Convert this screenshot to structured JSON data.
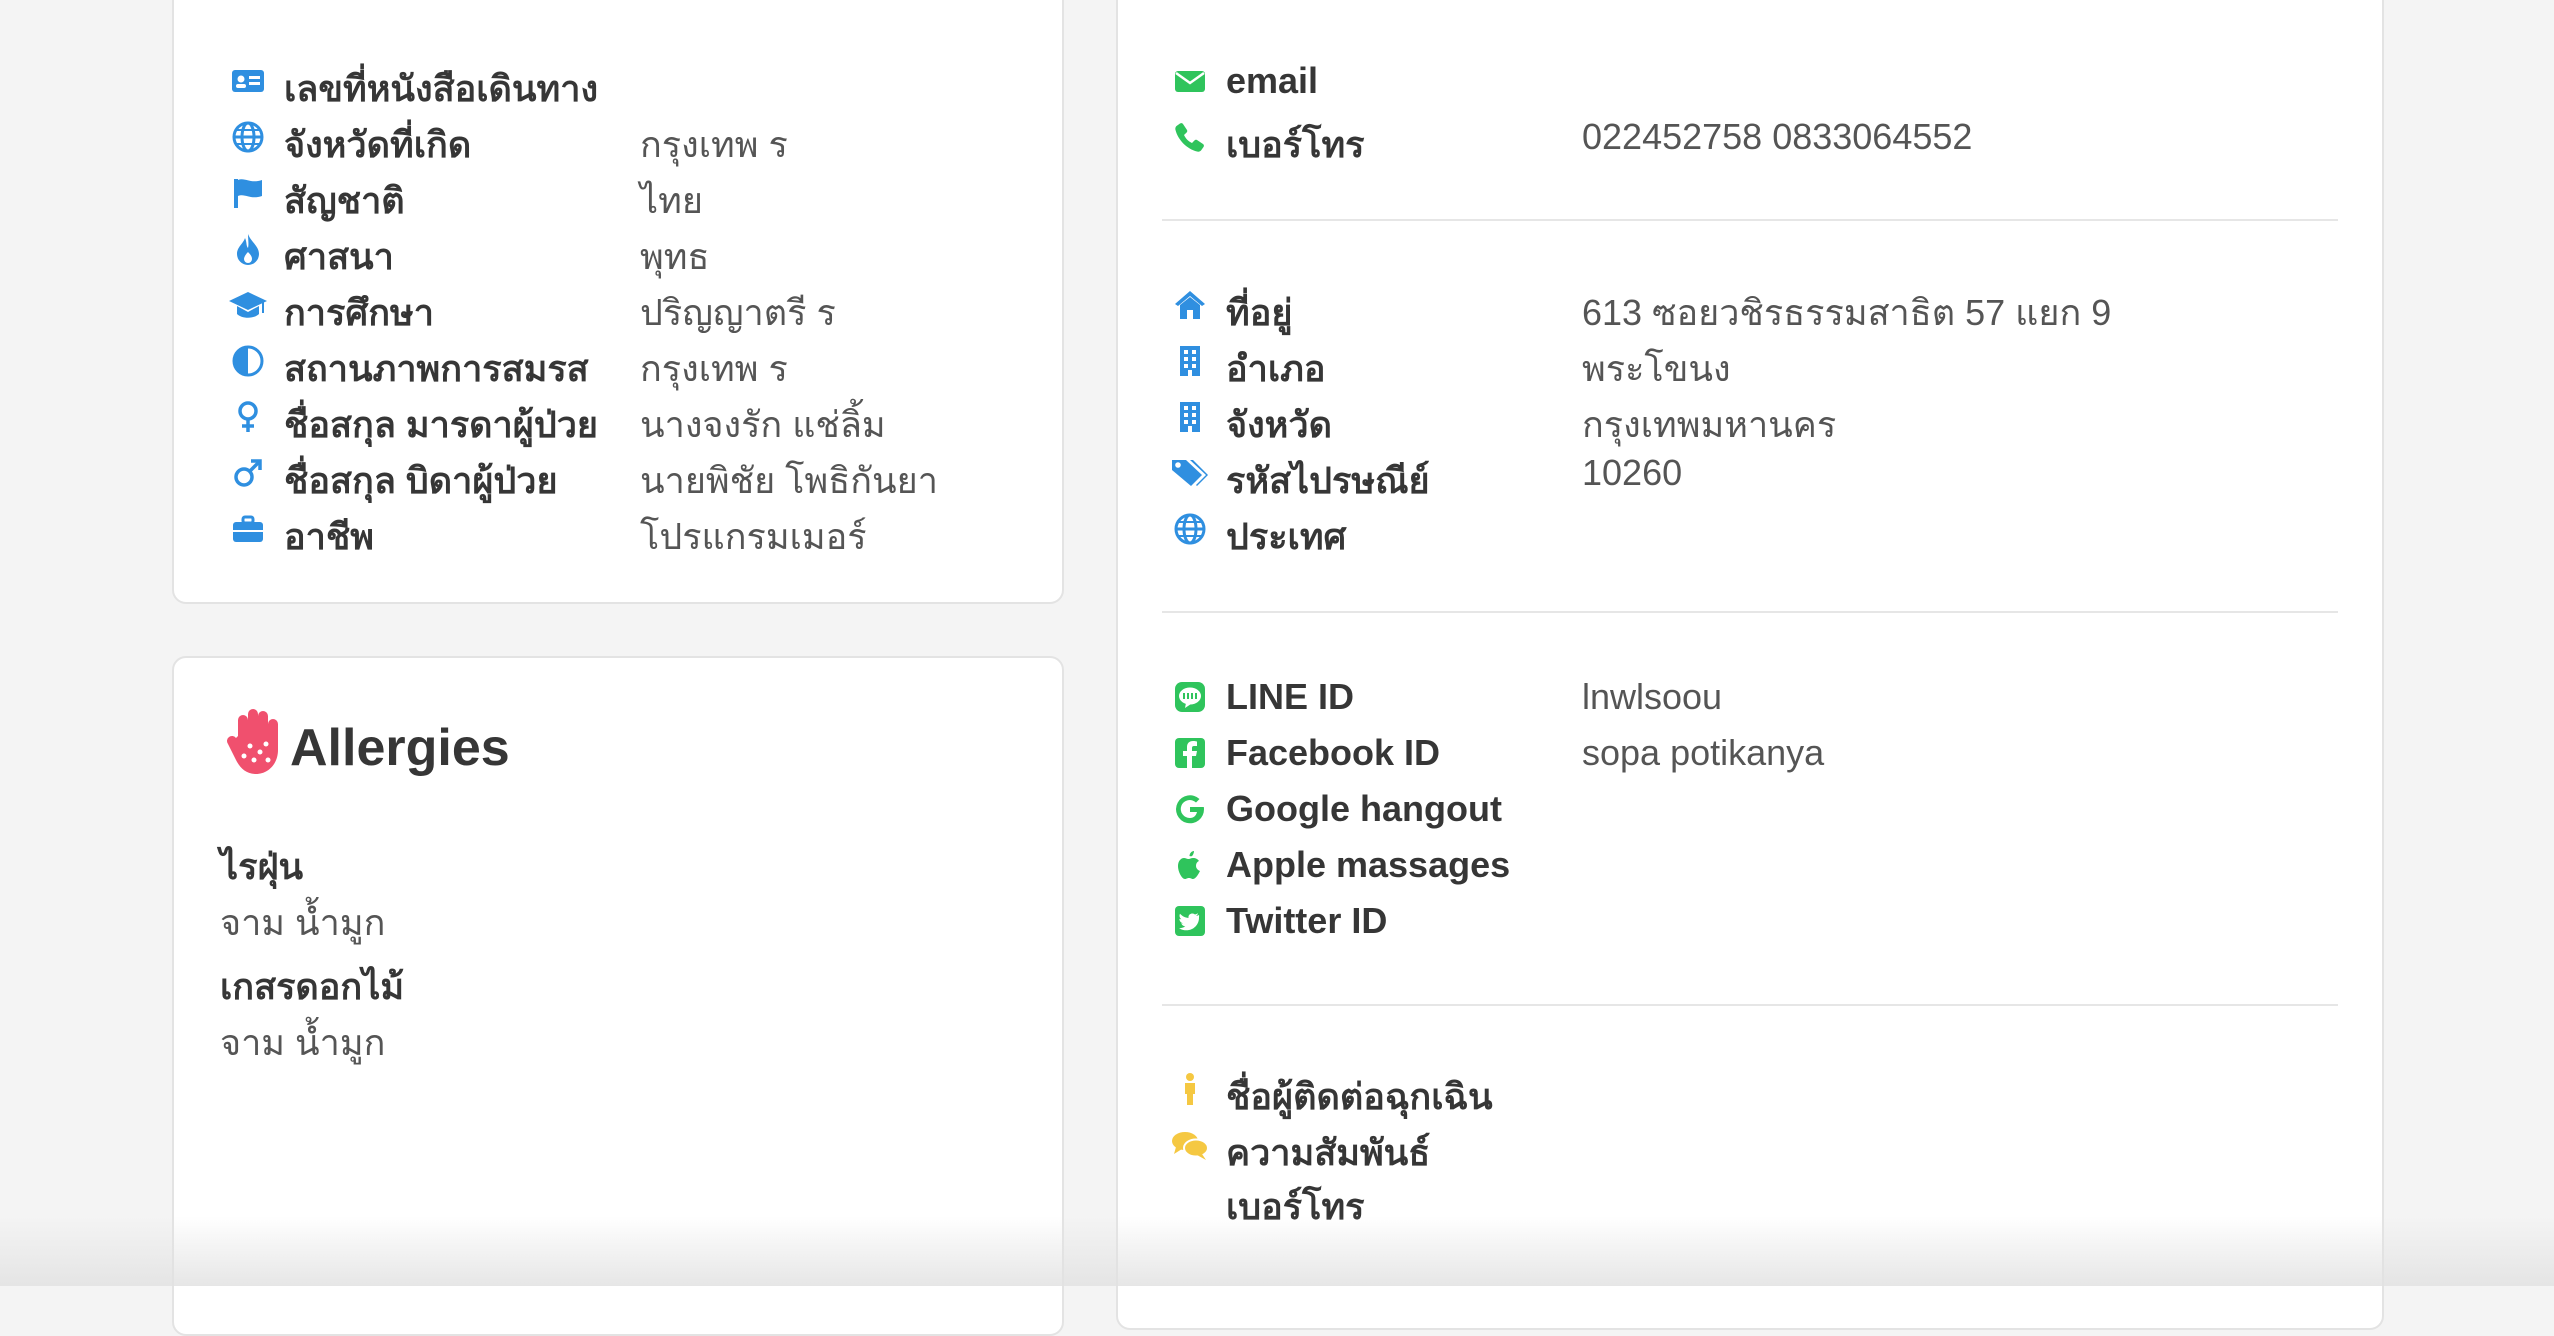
{
  "colors": {
    "personal_icon": "#2f8fe0",
    "contact_icon": "#2fc45c",
    "emergency_icon": "#f5c842",
    "allergy_icon": "#f0506e"
  },
  "personal": {
    "rows": [
      {
        "icon": "id-card-icon",
        "label": "เลขที่หนังสือเดินทาง",
        "value": ""
      },
      {
        "icon": "globe-icon",
        "label": "จังหวัดที่เกิด",
        "value": "กรุงเทพ ร"
      },
      {
        "icon": "flag-icon",
        "label": "สัญชาติ",
        "value": "ไทย"
      },
      {
        "icon": "flame-icon",
        "label": "ศาสนา",
        "value": "พุทธ"
      },
      {
        "icon": "graduation-cap-icon",
        "label": "การศึกษา",
        "value": "ปริญญาตรี ร"
      },
      {
        "icon": "half-circle-icon",
        "label": "สถานภาพการสมรส",
        "value": "กรุงเทพ ร"
      },
      {
        "icon": "venus-icon",
        "label": "ชื่อสกุล มารดาผู้ป่วย",
        "value": "นางจงรัก แช่ลิ้ม"
      },
      {
        "icon": "mars-icon",
        "label": "ชื่อสกุล บิดาผู้ป่วย",
        "value": "นายพิชัย โพธิกันยา"
      },
      {
        "icon": "briefcase-icon",
        "label": "อาชีพ",
        "value": "โปรแกรมเมอร์"
      }
    ]
  },
  "allergies": {
    "title": "Allergies",
    "icon": "allergy-hand-icon",
    "items": [
      {
        "name": "ไรฝุ่น",
        "desc": "จาม น้ำมูก"
      },
      {
        "name": "เกสรดอกไม้",
        "desc": "จาม น้ำมูก"
      }
    ]
  },
  "contact": {
    "basic": [
      {
        "icon": "envelope-icon",
        "label": "email",
        "value": ""
      },
      {
        "icon": "phone-icon",
        "label": "เบอร์โทร",
        "value": "022452758 0833064552"
      }
    ],
    "address": [
      {
        "icon": "home-icon",
        "label": "ที่อยู่",
        "value": "613 ซอยวชิรธรรมสาธิต 57 แยก 9"
      },
      {
        "icon": "building-icon",
        "label": "อำเภอ",
        "value": "พระโขนง"
      },
      {
        "icon": "building-icon",
        "label": "จังหวัด",
        "value": "กรุงเทพมหานคร"
      },
      {
        "icon": "tags-icon",
        "label": "รหัสไปรษณีย์",
        "value": "10260"
      },
      {
        "icon": "globe-icon",
        "label": "ประเทศ",
        "value": ""
      }
    ],
    "social": [
      {
        "icon": "line-icon",
        "label": "LINE ID",
        "value": "lnwlsoou"
      },
      {
        "icon": "facebook-icon",
        "label": "Facebook ID",
        "value": "sopa potikanya"
      },
      {
        "icon": "google-icon",
        "label": "Google hangout",
        "value": ""
      },
      {
        "icon": "apple-icon",
        "label": "Apple massages",
        "value": ""
      },
      {
        "icon": "twitter-icon",
        "label": "Twitter ID",
        "value": ""
      }
    ],
    "emergency": [
      {
        "icon": "person-icon",
        "label": "ชื่อผู้ติดต่อฉุกเฉิน",
        "value": ""
      },
      {
        "icon": "comments-icon",
        "label": "ความสัมพันธ์",
        "value": ""
      },
      {
        "icon": "",
        "label": "เบอร์โทร",
        "value": ""
      }
    ]
  }
}
